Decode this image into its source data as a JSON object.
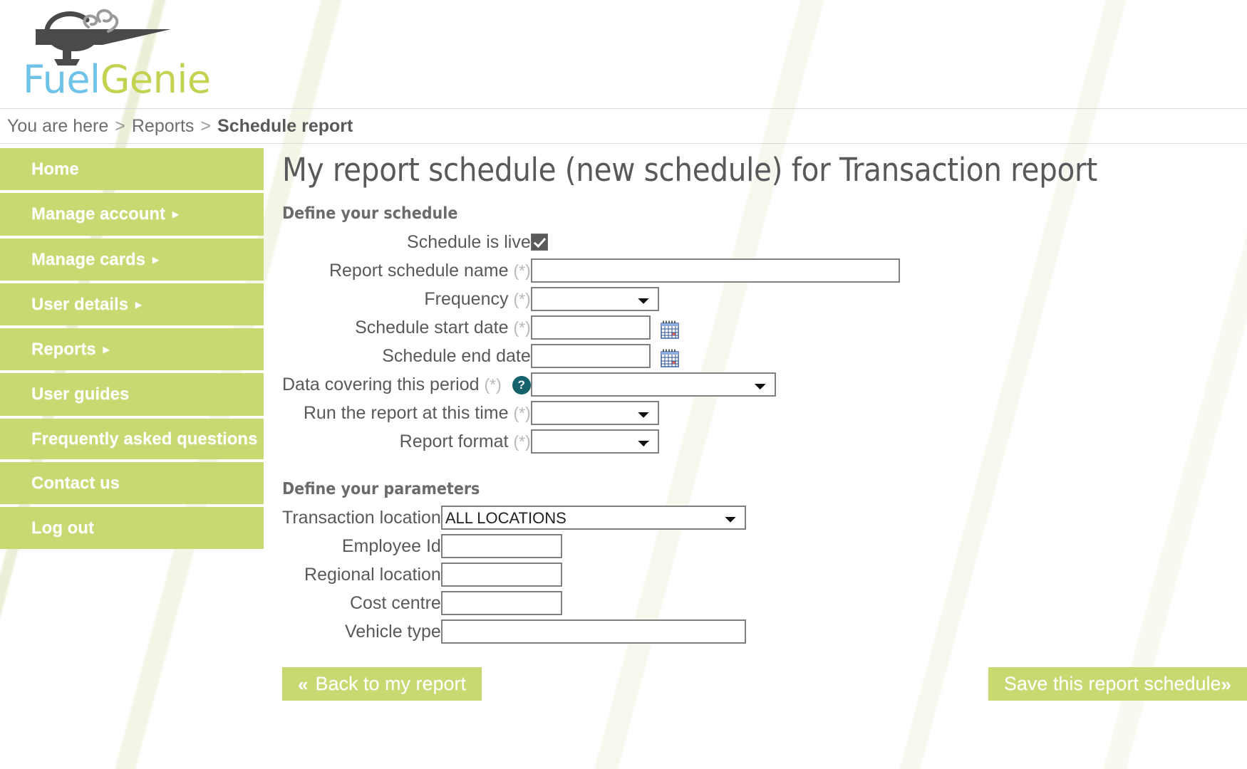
{
  "brand": {
    "name_part1": "Fuel",
    "name_part2": "Genie",
    "logo_icon": "genie-lamp-icon",
    "color_fuel": "#6fc3e8",
    "color_genie": "#c3d250"
  },
  "breadcrumb": {
    "prefix": "You are here",
    "separator": ">",
    "parent": "Reports",
    "current": "Schedule report"
  },
  "sidebar": {
    "items": [
      {
        "label": "Home",
        "has_submenu": false
      },
      {
        "label": "Manage account",
        "has_submenu": true
      },
      {
        "label": "Manage cards",
        "has_submenu": true
      },
      {
        "label": "User details",
        "has_submenu": true
      },
      {
        "label": "Reports",
        "has_submenu": true
      },
      {
        "label": "User guides",
        "has_submenu": false
      },
      {
        "label": "Frequently asked questions",
        "has_submenu": false
      },
      {
        "label": "Contact us",
        "has_submenu": false
      },
      {
        "label": "Log out",
        "has_submenu": false
      }
    ],
    "arrow_glyph": "▸",
    "background_color": "#c9d870"
  },
  "main": {
    "page_title": "My report schedule (new schedule) for Transaction report",
    "schedule_section": {
      "heading": "Define your schedule",
      "required_marker": "(*)",
      "fields": {
        "schedule_live": {
          "label": "Schedule is live",
          "checked": true
        },
        "schedule_name": {
          "label": "Report schedule name",
          "required": true,
          "value": "",
          "placeholder": ""
        },
        "frequency": {
          "label": "Frequency",
          "required": true,
          "value": "",
          "options": [
            ""
          ]
        },
        "start_date": {
          "label": "Schedule start date",
          "required": true,
          "value": "",
          "placeholder": "",
          "calendar_icon": "calendar-icon"
        },
        "end_date": {
          "label": "Schedule end date",
          "required": false,
          "value": "",
          "placeholder": "",
          "calendar_icon": "calendar-icon"
        },
        "data_period": {
          "label": "Data covering this period",
          "required": true,
          "value": "",
          "options": [
            ""
          ],
          "help_icon": "help-icon",
          "help_glyph": "?"
        },
        "run_time": {
          "label": "Run the report at this time",
          "required": true,
          "value": "",
          "options": [
            ""
          ]
        },
        "report_format": {
          "label": "Report format",
          "required": true,
          "value": "",
          "options": [
            ""
          ]
        }
      }
    },
    "parameters_section": {
      "heading": "Define your parameters",
      "fields": {
        "transaction_location": {
          "label": "Transaction location",
          "value": "ALL LOCATIONS",
          "options": [
            "ALL LOCATIONS"
          ]
        },
        "employee_id": {
          "label": "Employee Id",
          "value": "",
          "placeholder": ""
        },
        "regional_location": {
          "label": "Regional location",
          "value": "",
          "placeholder": ""
        },
        "cost_centre": {
          "label": "Cost centre",
          "value": "",
          "placeholder": ""
        },
        "vehicle_type": {
          "label": "Vehicle type",
          "value": "",
          "placeholder": ""
        }
      }
    }
  },
  "footer": {
    "back_button": {
      "label": "Back to my report",
      "icon": "double-chevron-left-icon",
      "glyph": "«"
    },
    "save_button": {
      "label": "Save this report schedule",
      "icon": "double-chevron-right-icon",
      "glyph": "»"
    }
  }
}
